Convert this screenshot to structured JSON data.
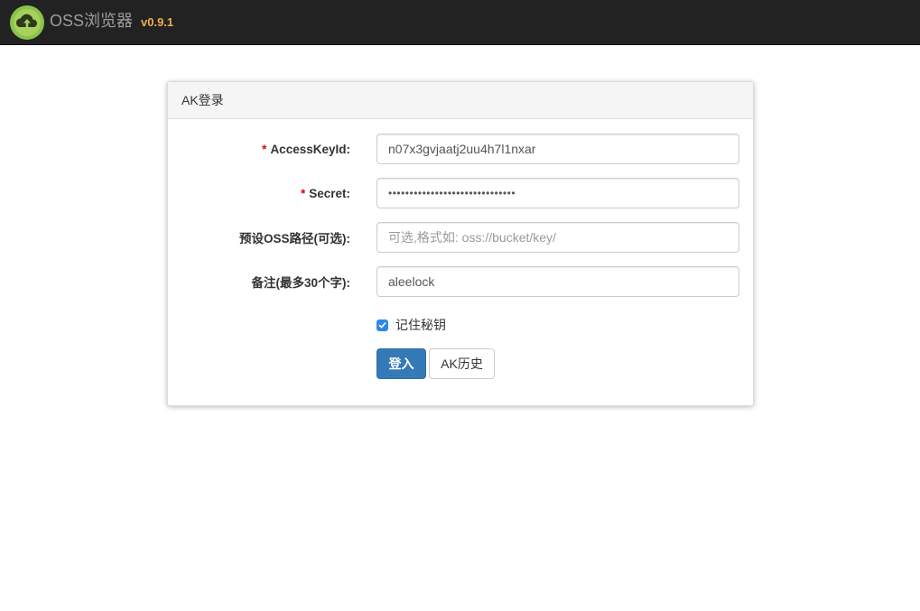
{
  "app": {
    "name": "OSS浏览器",
    "version": "v0.9.1",
    "logo_icon": "cloud-upload-logo-icon"
  },
  "colors": {
    "topbar_bg": "#222222",
    "version_color": "#f0ad4e",
    "primary_button": "#337ab7",
    "required_mark": "#d9000c"
  },
  "panel": {
    "title": "AK登录"
  },
  "form": {
    "access_key_id": {
      "required_mark": "*",
      "label": "AccessKeyId:",
      "value": "n07x3gvjaatj2uu4h7l1nxar"
    },
    "secret": {
      "required_mark": "*",
      "label": "Secret:",
      "value": "••••••••••••••••••••••••••••••"
    },
    "preset_path": {
      "label": "预设OSS路径(可选):",
      "value": "",
      "placeholder": "可选,格式如: oss://bucket/key/"
    },
    "note": {
      "label": "备注(最多30个字):",
      "value": "aleelock"
    },
    "remember": {
      "label": "记住秘钥",
      "checked": true
    },
    "buttons": {
      "login": "登入",
      "history": "AK历史"
    }
  }
}
